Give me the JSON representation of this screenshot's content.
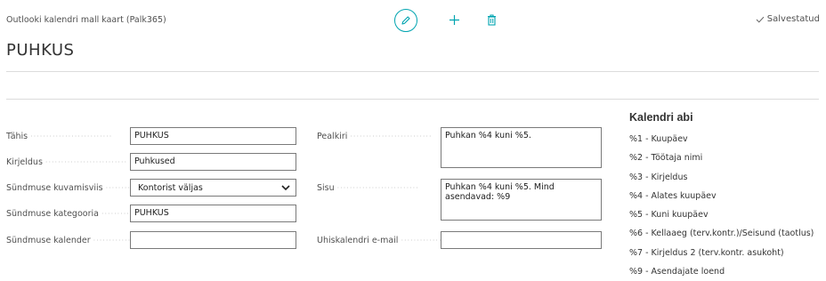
{
  "header": {
    "caption": "Outlooki kalendri mall kaart (Palk365)",
    "title": "PUHKUS",
    "saved_label": "Salvestatud"
  },
  "actions": {
    "edit": "pencil-icon",
    "new": "plus-icon",
    "delete": "trash-icon"
  },
  "fields_left": [
    {
      "label": "Tähis",
      "value": "PUHKUS"
    },
    {
      "label": "Kirjeldus",
      "value": "Puhkused"
    },
    {
      "label": "Sündmuse kuvamisviis",
      "value": "Kontorist väljas"
    },
    {
      "label": "Sündmuse kategooria",
      "value": "PUHKUS"
    },
    {
      "label": "Sündmuse kalender",
      "value": ""
    }
  ],
  "fields_mid": [
    {
      "label": "Pealkiri",
      "value": "Puhkan %4 kuni %5."
    },
    {
      "label": "Sisu",
      "value": "Puhkan %4 kuni %5. Mind asendavad: %9"
    },
    {
      "label": "Ühiskalendri e-mail",
      "value": ""
    }
  ],
  "help": {
    "title": "Kalendri abi",
    "items": [
      "%1 - Kuupäev",
      "%2 - Töötaja nimi",
      "%3 - Kirjeldus",
      "%4 - Alates kuupäev",
      "%5 - Kuni kuupäev",
      "%6 - Kellaaeg (terv.kontr.)/Seisund (taotlus)",
      "%7 - Kirjeldus 2 (terv.kontr. asukoht)",
      "%9 - Asendajate loend"
    ]
  },
  "colors": {
    "accent": "#00a4b0"
  }
}
